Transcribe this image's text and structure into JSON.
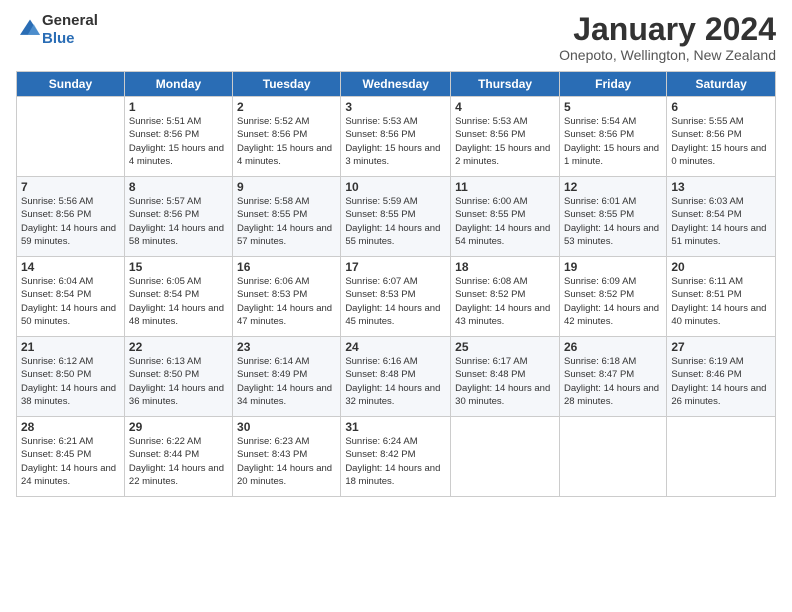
{
  "header": {
    "logo_general": "General",
    "logo_blue": "Blue",
    "month_title": "January 2024",
    "location": "Onepoto, Wellington, New Zealand"
  },
  "weekdays": [
    "Sunday",
    "Monday",
    "Tuesday",
    "Wednesday",
    "Thursday",
    "Friday",
    "Saturday"
  ],
  "weeks": [
    [
      {
        "day": "",
        "empty": true
      },
      {
        "day": "1",
        "sunrise": "5:51 AM",
        "sunset": "8:56 PM",
        "daylight": "15 hours and 4 minutes."
      },
      {
        "day": "2",
        "sunrise": "5:52 AM",
        "sunset": "8:56 PM",
        "daylight": "15 hours and 4 minutes."
      },
      {
        "day": "3",
        "sunrise": "5:53 AM",
        "sunset": "8:56 PM",
        "daylight": "15 hours and 3 minutes."
      },
      {
        "day": "4",
        "sunrise": "5:53 AM",
        "sunset": "8:56 PM",
        "daylight": "15 hours and 2 minutes."
      },
      {
        "day": "5",
        "sunrise": "5:54 AM",
        "sunset": "8:56 PM",
        "daylight": "15 hours and 1 minute."
      },
      {
        "day": "6",
        "sunrise": "5:55 AM",
        "sunset": "8:56 PM",
        "daylight": "15 hours and 0 minutes."
      }
    ],
    [
      {
        "day": "7",
        "sunrise": "5:56 AM",
        "sunset": "8:56 PM",
        "daylight": "14 hours and 59 minutes."
      },
      {
        "day": "8",
        "sunrise": "5:57 AM",
        "sunset": "8:56 PM",
        "daylight": "14 hours and 58 minutes."
      },
      {
        "day": "9",
        "sunrise": "5:58 AM",
        "sunset": "8:55 PM",
        "daylight": "14 hours and 57 minutes."
      },
      {
        "day": "10",
        "sunrise": "5:59 AM",
        "sunset": "8:55 PM",
        "daylight": "14 hours and 55 minutes."
      },
      {
        "day": "11",
        "sunrise": "6:00 AM",
        "sunset": "8:55 PM",
        "daylight": "14 hours and 54 minutes."
      },
      {
        "day": "12",
        "sunrise": "6:01 AM",
        "sunset": "8:55 PM",
        "daylight": "14 hours and 53 minutes."
      },
      {
        "day": "13",
        "sunrise": "6:03 AM",
        "sunset": "8:54 PM",
        "daylight": "14 hours and 51 minutes."
      }
    ],
    [
      {
        "day": "14",
        "sunrise": "6:04 AM",
        "sunset": "8:54 PM",
        "daylight": "14 hours and 50 minutes."
      },
      {
        "day": "15",
        "sunrise": "6:05 AM",
        "sunset": "8:54 PM",
        "daylight": "14 hours and 48 minutes."
      },
      {
        "day": "16",
        "sunrise": "6:06 AM",
        "sunset": "8:53 PM",
        "daylight": "14 hours and 47 minutes."
      },
      {
        "day": "17",
        "sunrise": "6:07 AM",
        "sunset": "8:53 PM",
        "daylight": "14 hours and 45 minutes."
      },
      {
        "day": "18",
        "sunrise": "6:08 AM",
        "sunset": "8:52 PM",
        "daylight": "14 hours and 43 minutes."
      },
      {
        "day": "19",
        "sunrise": "6:09 AM",
        "sunset": "8:52 PM",
        "daylight": "14 hours and 42 minutes."
      },
      {
        "day": "20",
        "sunrise": "6:11 AM",
        "sunset": "8:51 PM",
        "daylight": "14 hours and 40 minutes."
      }
    ],
    [
      {
        "day": "21",
        "sunrise": "6:12 AM",
        "sunset": "8:50 PM",
        "daylight": "14 hours and 38 minutes."
      },
      {
        "day": "22",
        "sunrise": "6:13 AM",
        "sunset": "8:50 PM",
        "daylight": "14 hours and 36 minutes."
      },
      {
        "day": "23",
        "sunrise": "6:14 AM",
        "sunset": "8:49 PM",
        "daylight": "14 hours and 34 minutes."
      },
      {
        "day": "24",
        "sunrise": "6:16 AM",
        "sunset": "8:48 PM",
        "daylight": "14 hours and 32 minutes."
      },
      {
        "day": "25",
        "sunrise": "6:17 AM",
        "sunset": "8:48 PM",
        "daylight": "14 hours and 30 minutes."
      },
      {
        "day": "26",
        "sunrise": "6:18 AM",
        "sunset": "8:47 PM",
        "daylight": "14 hours and 28 minutes."
      },
      {
        "day": "27",
        "sunrise": "6:19 AM",
        "sunset": "8:46 PM",
        "daylight": "14 hours and 26 minutes."
      }
    ],
    [
      {
        "day": "28",
        "sunrise": "6:21 AM",
        "sunset": "8:45 PM",
        "daylight": "14 hours and 24 minutes."
      },
      {
        "day": "29",
        "sunrise": "6:22 AM",
        "sunset": "8:44 PM",
        "daylight": "14 hours and 22 minutes."
      },
      {
        "day": "30",
        "sunrise": "6:23 AM",
        "sunset": "8:43 PM",
        "daylight": "14 hours and 20 minutes."
      },
      {
        "day": "31",
        "sunrise": "6:24 AM",
        "sunset": "8:42 PM",
        "daylight": "14 hours and 18 minutes."
      },
      {
        "day": "",
        "empty": true
      },
      {
        "day": "",
        "empty": true
      },
      {
        "day": "",
        "empty": true
      }
    ]
  ]
}
